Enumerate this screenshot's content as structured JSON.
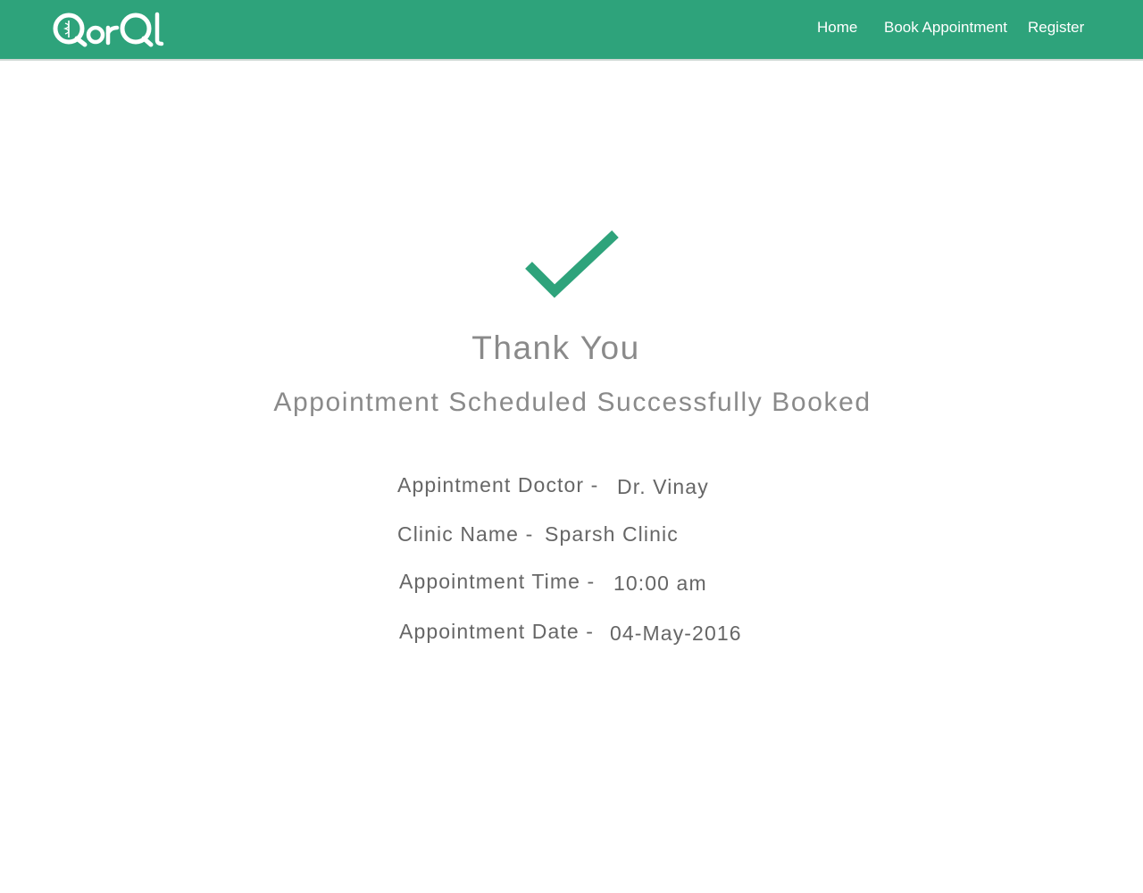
{
  "header": {
    "logo_text": "QorQl",
    "nav": {
      "home": "Home",
      "book_appointment": "Book Appointment",
      "register": "Register"
    },
    "background_color": "#2ea37b"
  },
  "confirmation": {
    "icon": "checkmark-icon",
    "icon_color": "#2ea37b",
    "title": "Thank You",
    "subtitle": "Appointment Scheduled Successfully Booked"
  },
  "details": {
    "doctor_label": "Appintment Doctor - ",
    "doctor_value": "Dr. Vinay",
    "clinic_label": "Clinic Name - ",
    "clinic_value": "Sparsh Clinic",
    "time_label": "Appointment Time - ",
    "time_value": "10:00 am",
    "date_label": "Appointment Date - ",
    "date_value": "04-May-2016"
  }
}
